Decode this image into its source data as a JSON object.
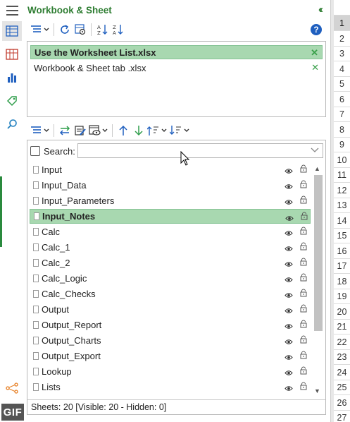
{
  "header": {
    "title": "Workbook & Sheet"
  },
  "rail": {
    "icons": [
      "sheet-icon",
      "workbook-icon",
      "chart-icon",
      "tag-icon",
      "search-icon",
      "share-icon"
    ],
    "badge": "GIF"
  },
  "workbooks": {
    "items": [
      {
        "name": "Use the Worksheet List.xlsx",
        "selected": true
      },
      {
        "name": "Workbook & Sheet tab .xlsx",
        "selected": false
      }
    ]
  },
  "search": {
    "label": "Search:",
    "value": ""
  },
  "sheets": {
    "items": [
      {
        "name": "Input",
        "selected": false
      },
      {
        "name": "Input_Data",
        "selected": false
      },
      {
        "name": "Input_Parameters",
        "selected": false
      },
      {
        "name": "Input_Notes",
        "selected": true
      },
      {
        "name": "Calc",
        "selected": false
      },
      {
        "name": "Calc_1",
        "selected": false
      },
      {
        "name": "Calc_2",
        "selected": false
      },
      {
        "name": "Calc_Logic",
        "selected": false
      },
      {
        "name": "Calc_Checks",
        "selected": false
      },
      {
        "name": "Output",
        "selected": false
      },
      {
        "name": "Output_Report",
        "selected": false
      },
      {
        "name": "Output_Charts",
        "selected": false
      },
      {
        "name": "Output_Export",
        "selected": false
      },
      {
        "name": "Lookup",
        "selected": false
      },
      {
        "name": "Lists",
        "selected": false
      }
    ]
  },
  "status": {
    "text": "Sheets: 20  [Visible: 20 - Hidden: 0]"
  },
  "row_headers": {
    "labels": [
      "1",
      "2",
      "3",
      "4",
      "5",
      "6",
      "7",
      "8",
      "9",
      "10",
      "11",
      "12",
      "13",
      "14",
      "15",
      "16",
      "17",
      "18",
      "19",
      "20",
      "21",
      "22",
      "23",
      "24",
      "25",
      "26",
      "27"
    ],
    "active": "1"
  },
  "colors": {
    "accent": "#2e7d32",
    "selection": "#a8d8b0",
    "help": "#1f5fbf"
  }
}
